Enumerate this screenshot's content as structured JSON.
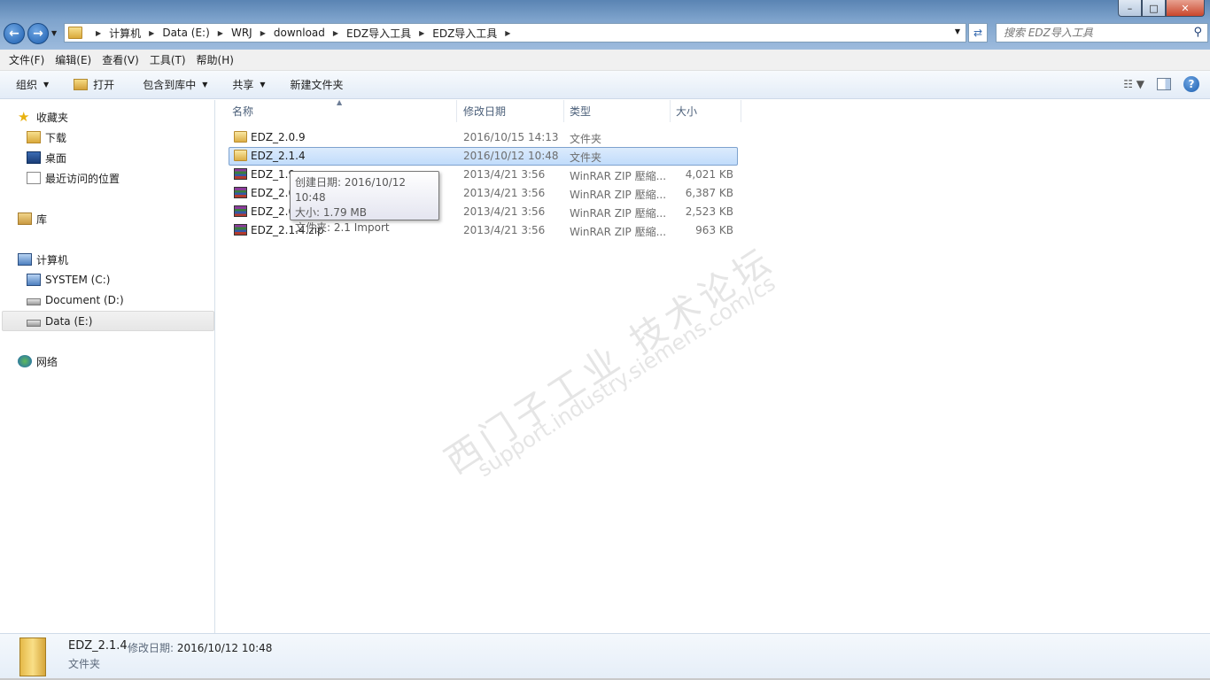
{
  "window": {
    "controls": {
      "minimize": "–",
      "maximize": "□",
      "close": "✕"
    }
  },
  "address": {
    "crumbs": [
      "计算机",
      "Data (E:)",
      "WRJ",
      "download",
      "EDZ导入工具",
      "EDZ导入工具"
    ]
  },
  "search": {
    "placeholder": "搜索 EDZ导入工具"
  },
  "menu": [
    "文件(F)",
    "编辑(E)",
    "查看(V)",
    "工具(T)",
    "帮助(H)"
  ],
  "toolbar": {
    "organize": "组织",
    "open": "打开",
    "include_library": "包含到库中",
    "share": "共享",
    "new_folder": "新建文件夹"
  },
  "nav": {
    "favorites": "收藏夹",
    "downloads": "下载",
    "desktop": "桌面",
    "recent": "最近访问的位置",
    "libraries": "库",
    "computer": "计算机",
    "drive_c": "SYSTEM (C:)",
    "drive_d": "Document (D:)",
    "drive_e": "Data (E:)",
    "network": "网络"
  },
  "columns": {
    "name": "名称",
    "date": "修改日期",
    "type": "类型",
    "size": "大小"
  },
  "files": [
    {
      "name": "EDZ_2.0.9",
      "date": "2016/10/15 14:13",
      "type": "文件夹",
      "size": "",
      "icon": "folder"
    },
    {
      "name": "EDZ_2.1.4",
      "date": "2016/10/12 10:48",
      "type": "文件夹",
      "size": "",
      "icon": "folder"
    },
    {
      "name": "EDZ_1.9",
      "date": "2013/4/21 3:56",
      "type": "WinRAR ZIP 壓縮...",
      "size": "4,021 KB",
      "icon": "rar"
    },
    {
      "name": "EDZ_2.0",
      "date": "2013/4/21 3:56",
      "type": "WinRAR ZIP 壓縮...",
      "size": "6,387 KB",
      "icon": "rar"
    },
    {
      "name": "EDZ_2.0",
      "date": "2013/4/21 3:56",
      "type": "WinRAR ZIP 壓縮...",
      "size": "2,523 KB",
      "icon": "rar"
    },
    {
      "name": "EDZ_2.1.4.zip",
      "date": "2013/4/21 3:56",
      "type": "WinRAR ZIP 壓縮...",
      "size": "963 KB",
      "icon": "rar"
    }
  ],
  "tooltip": {
    "created": "创建日期: 2016/10/12 10:48",
    "size": "大小: 1.79 MB",
    "folder": "文件夹: 2.1 Import"
  },
  "watermark": {
    "line1": "西门子工业 技术论坛",
    "line2": "support.industry.siemens.com/cs"
  },
  "details": {
    "name": "EDZ_2.1.4",
    "modified_label": "修改日期:",
    "modified_value": "2016/10/12 10:48",
    "type": "文件夹"
  }
}
